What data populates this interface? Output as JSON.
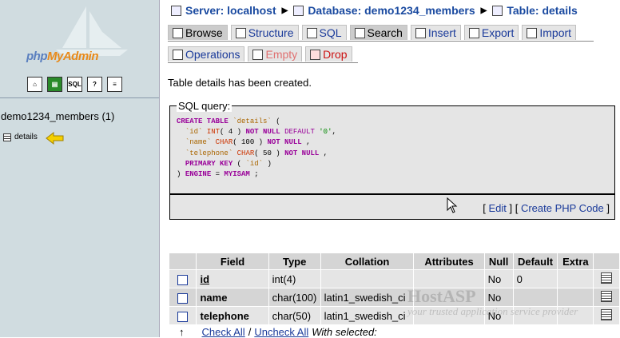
{
  "sidebar": {
    "logo": {
      "part1": "php",
      "part2": "MyAdmin"
    },
    "icons": [
      "home-icon",
      "query-window-icon",
      "sql-icon",
      "docs-icon",
      "changelog-icon"
    ],
    "db_label": "demo1234_members (1)",
    "tables": [
      {
        "label": "details"
      }
    ]
  },
  "breadcrumb": {
    "server": "Server: localhost",
    "database": "Database: demo1234_members",
    "table": "Table: details"
  },
  "tabs": {
    "browse": "Browse",
    "structure": "Structure",
    "sql": "SQL",
    "search": "Search",
    "insert": "Insert",
    "export": "Export",
    "import": "Import",
    "operations": "Operations",
    "empty": "Empty",
    "drop": "Drop"
  },
  "message": "Table details has been created.",
  "sql_query": {
    "legend": "SQL query:",
    "edit": "Edit",
    "create_php": "Create PHP Code"
  },
  "columns": {
    "headers": [
      "Field",
      "Type",
      "Collation",
      "Attributes",
      "Null",
      "Default",
      "Extra"
    ],
    "rows": [
      {
        "field": "id",
        "type": "int(4)",
        "collation": "",
        "attributes": "",
        "null": "No",
        "default": "0",
        "extra": ""
      },
      {
        "field": "name",
        "type": "char(100)",
        "collation": "latin1_swedish_ci",
        "attributes": "",
        "null": "No",
        "default": "",
        "extra": ""
      },
      {
        "field": "telephone",
        "type": "char(50)",
        "collation": "latin1_swedish_ci",
        "attributes": "",
        "null": "No",
        "default": "",
        "extra": ""
      }
    ]
  },
  "footer": {
    "check_all": "Check All",
    "slash": "/",
    "uncheck_all": "Uncheck All",
    "with_selected": "With selected:"
  },
  "watermark": {
    "line1": "HostASP",
    "line2": "your trusted application service provider"
  }
}
